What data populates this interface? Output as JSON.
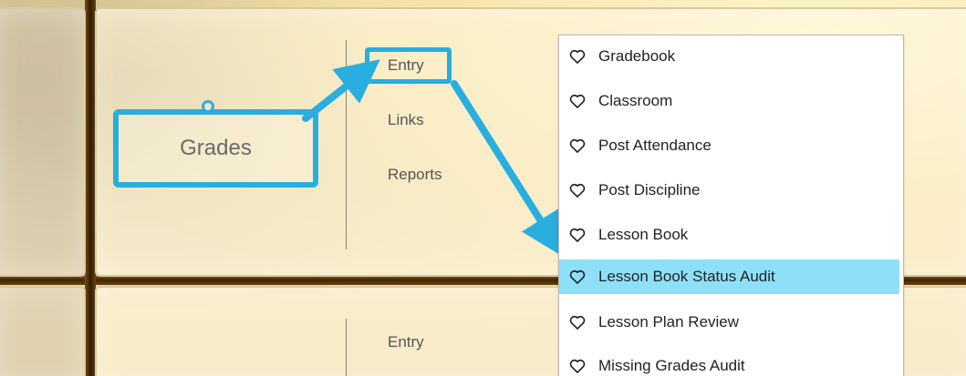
{
  "top_section": {
    "category_label": "Grades",
    "nav": [
      {
        "label": "Entry"
      },
      {
        "label": "Links"
      },
      {
        "label": "Reports"
      }
    ]
  },
  "bottom_section": {
    "nav": [
      {
        "label": "Entry"
      }
    ]
  },
  "dropdown": {
    "items": [
      {
        "label": "Gradebook",
        "icon": "heart-outline-icon"
      },
      {
        "label": "Classroom",
        "icon": "heart-outline-icon"
      },
      {
        "label": "Post Attendance",
        "icon": "heart-outline-icon"
      },
      {
        "label": "Post Discipline",
        "icon": "heart-outline-icon"
      },
      {
        "label": "Lesson Book",
        "icon": "heart-outline-icon"
      },
      {
        "label": "Lesson Book Status Audit",
        "icon": "heart-outline-icon",
        "highlighted": true
      },
      {
        "label": "Lesson Plan Review",
        "icon": "heart-outline-icon"
      },
      {
        "label": "Missing Grades Audit",
        "icon": "heart-outline-icon"
      }
    ]
  },
  "colors": {
    "annotation_blue": "#29aee0",
    "highlight_row": "#8ee0f8",
    "tile_border": "#d9c9a0"
  }
}
